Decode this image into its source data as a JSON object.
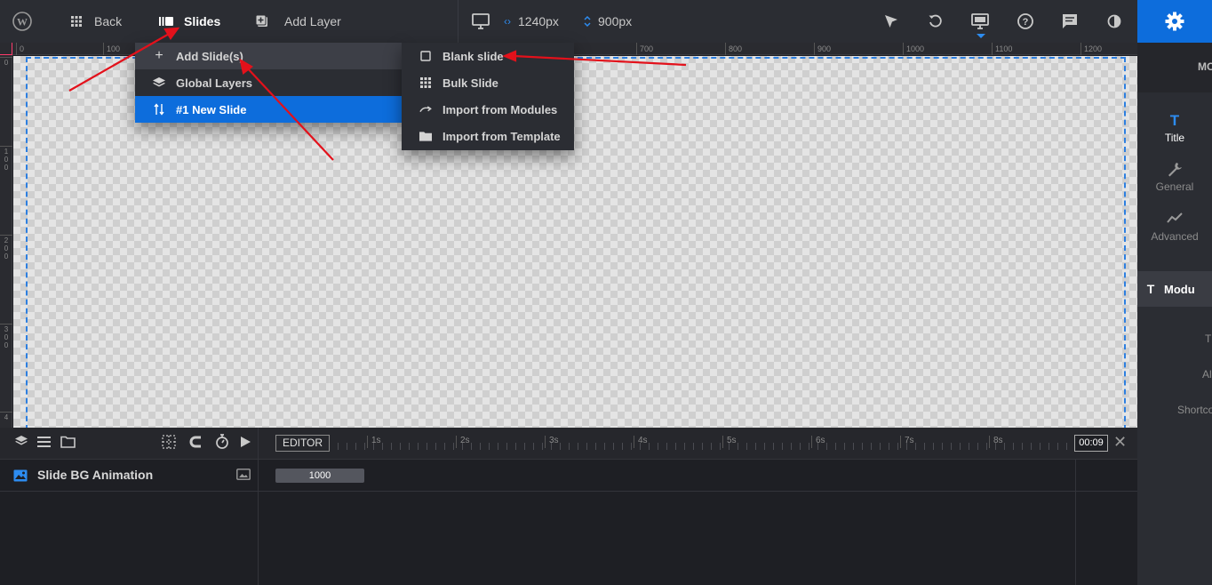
{
  "topbar": {
    "back_label": "Back",
    "slides_label": "Slides",
    "add_layer_label": "Add Layer",
    "width_value": "1240px",
    "height_value": "900px"
  },
  "ruler": {
    "top_ticks": [
      "0",
      "100",
      "700",
      "800",
      "900",
      "1000",
      "1100",
      "1200"
    ],
    "left_ticks": [
      "0",
      "1\n0\n0",
      "2\n0\n0",
      "3\n0\n0",
      "4"
    ]
  },
  "slides_menu": {
    "items": [
      {
        "label": "Add Slide(s)",
        "icon": "plus-icon"
      },
      {
        "label": "Global Layers",
        "icon": "layers-icon"
      },
      {
        "label": "#1 New Slide",
        "icon": "sort-icon"
      }
    ]
  },
  "add_submenu": {
    "items": [
      {
        "label": "Blank slide",
        "icon": "square-icon"
      },
      {
        "label": "Bulk Slide",
        "icon": "grid-icon"
      },
      {
        "label": "Import from Modules",
        "icon": "curved-arrow-icon"
      },
      {
        "label": "Import from Template",
        "icon": "folder-icon"
      }
    ]
  },
  "right_panel": {
    "header": "MO",
    "tabs": [
      {
        "label": "Title",
        "icon": "text-icon"
      },
      {
        "label": "General",
        "icon": "wrench-icon"
      },
      {
        "label": "Advanced",
        "icon": "chart-line-icon"
      }
    ],
    "section_title": "Modu",
    "fields": [
      "T",
      "Al",
      "Shortco"
    ]
  },
  "timeline": {
    "editor_label": "EDITOR",
    "time_labels": [
      "1s",
      "2s",
      "3s",
      "4s",
      "5s",
      "6s",
      "7s",
      "8s"
    ],
    "current_time": "00:09",
    "row_label": "Slide BG Animation",
    "bar_value": "1000"
  },
  "colors": {
    "accent": "#0d6ddc",
    "annotation": "#e3111b"
  }
}
